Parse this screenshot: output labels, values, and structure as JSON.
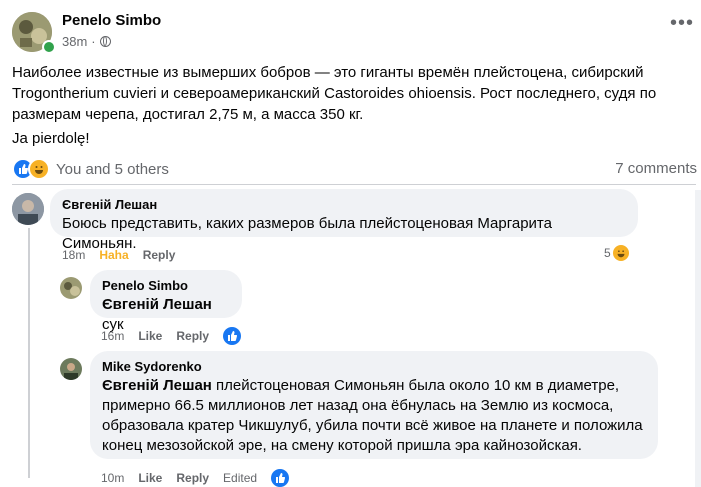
{
  "post": {
    "author": "Penelo Simbo",
    "time": "38m",
    "time_sep": "·",
    "more_icon": "•••",
    "text": "Наиболее известные из вымерших бобров — это гиганты времён плейстоцена, сибирский Trogontherium cuvieri и североамериканский Castoroides ohioensis. Рост последнего, судя по размерам черепа, достигал 2,75 м, а масса 350 кг.",
    "extra": "Ja pierdolę!",
    "reactions_text": "You and 5 others",
    "comments_count": "7 comments"
  },
  "comments": [
    {
      "author": "Євгеній Лешан",
      "text": "Боюсь представить, каких размеров была плейстоценовая Маргарита Симоньян.",
      "time": "18m",
      "reaction_label": "Haha",
      "reply_label": "Reply",
      "reaction_count": "5"
    },
    {
      "author": "Penelo Simbo",
      "tag": "Євгеній Лешан",
      "text": " сук",
      "time": "16m",
      "like_label": "Like",
      "reply_label": "Reply"
    },
    {
      "author": "Mike Sydorenko",
      "tag": "Євгеній Лешан",
      "text": " плейстоценовая Симоньян была около 10 км в диаметре, примерно 66.5 миллионов лет назад она ёбнулась на Землю из космоса, образовала кратер Чикшулуб, убила почти всё живое на планете и положила конец мезозойской эре, на смену которой пришла эра кайнозойская.",
      "time": "10m",
      "like_label": "Like",
      "reply_label": "Reply",
      "edited_label": "Edited"
    }
  ],
  "colors": {
    "like_blue": "#1877f2",
    "haha_yellow": "#f7b125",
    "bubble_bg": "#f0f2f5",
    "online_green": "#31a24c"
  },
  "icons": [
    "globe-icon",
    "more-icon",
    "like-reaction-icon",
    "haha-reaction-icon"
  ]
}
